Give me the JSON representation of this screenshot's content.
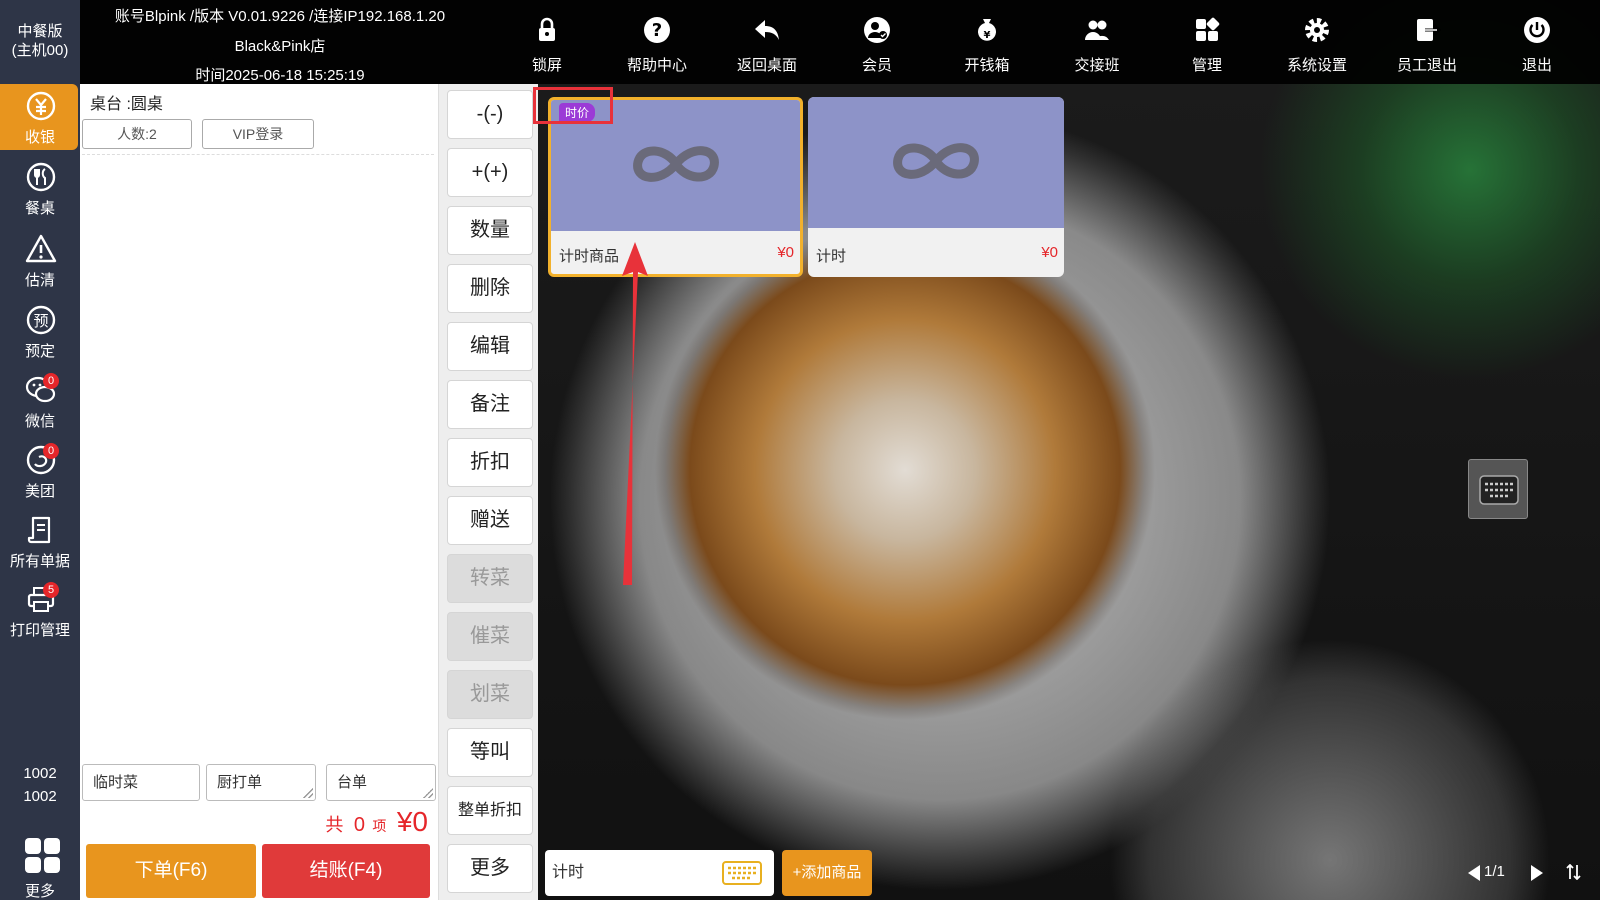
{
  "app": {
    "edition": "中餐版",
    "host": "(主机00)",
    "account_line": "账号Blpink /版本 V0.01.9226 /连接IP192.168.1.20",
    "store": "Black&Pink店",
    "time_line": "时间2025-06-18 15:25:19"
  },
  "toolbar": [
    {
      "label": "锁屏",
      "icon": "lock-icon"
    },
    {
      "label": "帮助中心",
      "icon": "help-icon"
    },
    {
      "label": "返回桌面",
      "icon": "back-icon"
    },
    {
      "label": "会员",
      "icon": "member-icon"
    },
    {
      "label": "开钱箱",
      "icon": "cash-drawer-icon"
    },
    {
      "label": "交接班",
      "icon": "shift-handover-icon"
    },
    {
      "label": "管理",
      "icon": "manage-icon"
    },
    {
      "label": "系统设置",
      "icon": "settings-icon"
    },
    {
      "label": "员工退出",
      "icon": "staff-logout-icon"
    },
    {
      "label": "退出",
      "icon": "power-icon"
    }
  ],
  "sidebar": {
    "items": [
      {
        "label": "收银",
        "icon": "cashier-icon",
        "active": true
      },
      {
        "label": "餐桌",
        "icon": "dining-icon"
      },
      {
        "label": "估清",
        "icon": "warning-icon"
      },
      {
        "label": "预定",
        "icon": "reservation-icon"
      },
      {
        "label": "微信",
        "icon": "wechat-icon",
        "badge": "0"
      },
      {
        "label": "美团",
        "icon": "meituan-icon",
        "badge": "0"
      },
      {
        "label": "所有单据",
        "icon": "documents-icon"
      },
      {
        "label": "打印管理",
        "icon": "printer-icon",
        "badge": "5"
      }
    ],
    "terminal_1": "1002",
    "terminal_2": "1002",
    "more_label": "更多"
  },
  "order": {
    "table": "桌台 :圆桌",
    "guests_button": "人数:2",
    "vip_button": "VIP登录",
    "temp_dish": "临时菜",
    "kitchen_note": "厨打单",
    "table_note": "台单",
    "total_prefix": "共",
    "item_count": "0",
    "items_unit": "项",
    "total_amount": "¥0",
    "place_order": "下单(F6)",
    "checkout": "结账(F4)"
  },
  "actions": [
    {
      "label": "-(-)",
      "disabled": false
    },
    {
      "label": "+(+)",
      "disabled": false
    },
    {
      "label": "数量",
      "disabled": false
    },
    {
      "label": "删除",
      "disabled": false
    },
    {
      "label": "编辑",
      "disabled": false
    },
    {
      "label": "备注",
      "disabled": false
    },
    {
      "label": "折扣",
      "disabled": false
    },
    {
      "label": "赠送",
      "disabled": false
    },
    {
      "label": "转菜",
      "disabled": true
    },
    {
      "label": "催菜",
      "disabled": true
    },
    {
      "label": "划菜",
      "disabled": true
    },
    {
      "label": "等叫",
      "disabled": false
    },
    {
      "label": "整单折扣",
      "disabled": false
    },
    {
      "label": "更多",
      "disabled": false
    }
  ],
  "products": [
    {
      "name": "计时商品",
      "price": "¥0",
      "tag": "时价",
      "selected": true
    },
    {
      "name": "计时",
      "price": "¥0",
      "selected": false
    }
  ],
  "search": {
    "value": "计时"
  },
  "add_product": "+添加商品",
  "pager": {
    "page": "1/1"
  },
  "colors": {
    "accent": "#e8951e",
    "danger": "#e03a3a",
    "sidebar": "#2e3547",
    "tag": "#9b3bd6"
  }
}
